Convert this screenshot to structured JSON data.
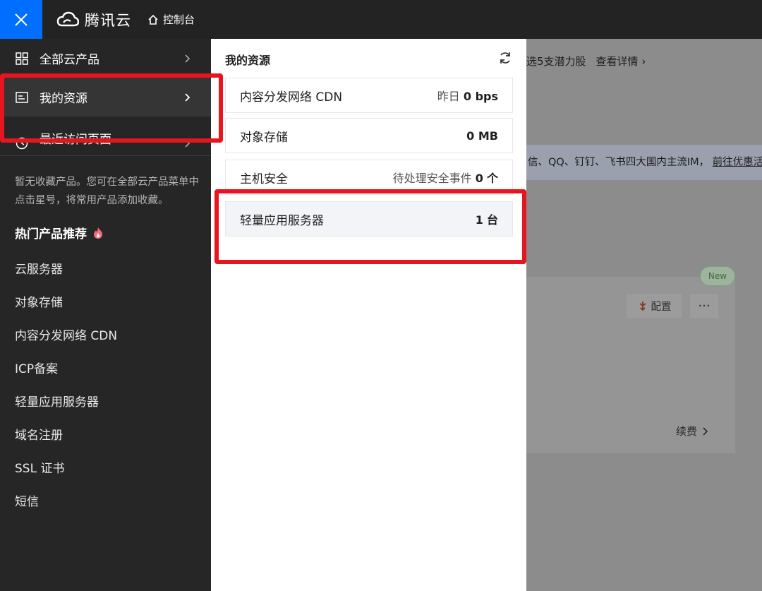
{
  "topbar": {
    "brand": "腾讯云",
    "console": "控制台"
  },
  "background": {
    "promo_text": "选5支潜力股",
    "promo_link": "查看详情 ›",
    "band_text": "信、QQ、钉钉、飞书四大国内主流IM，",
    "band_link": "前往优惠活",
    "new_badge": "New",
    "config_label": "配置",
    "more_label": "···",
    "renew_label": "续费"
  },
  "sidebar": {
    "nav": [
      {
        "label": "全部云产品"
      },
      {
        "label": "我的资源"
      },
      {
        "label": "最近访问页面"
      }
    ],
    "hint": "暂无收藏产品。您可在全部云产品菜单中点击星号，将常用产品添加收藏。",
    "hot_title": "热门产品推荐",
    "hot_items": [
      "云服务器",
      "对象存储",
      "内容分发网络 CDN",
      "ICP备案",
      "轻量应用服务器",
      "域名注册",
      "SSL 证书",
      "短信"
    ]
  },
  "panel": {
    "title": "我的资源",
    "items": [
      {
        "name": "内容分发网络 CDN",
        "prefix": "昨日",
        "value": "0 bps",
        "suffix": ""
      },
      {
        "name": "对象存储",
        "prefix": "",
        "value": "0 MB",
        "suffix": ""
      },
      {
        "name": "主机安全",
        "prefix": "待处理安全事件",
        "value": "0",
        "suffix": "个"
      },
      {
        "name": "轻量应用服务器",
        "prefix": "",
        "value": "1",
        "suffix": "台"
      }
    ]
  },
  "colors": {
    "accent": "#006eff",
    "annotation": "#e8141e",
    "sidebar_bg": "#262626"
  }
}
